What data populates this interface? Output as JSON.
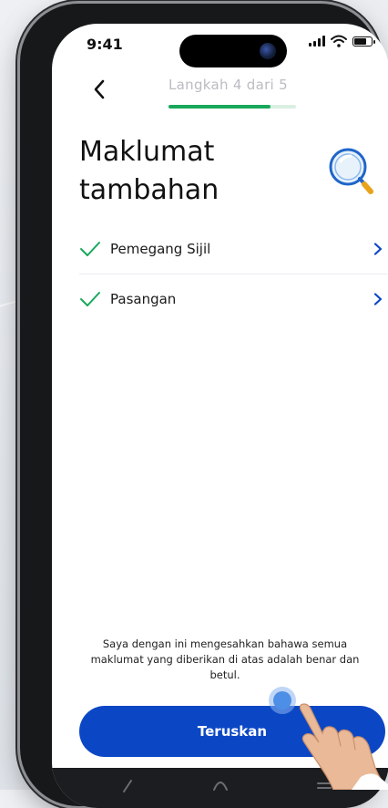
{
  "status_bar": {
    "time": "9:41",
    "signal_icon": "cellular-signal-icon",
    "wifi_icon": "wifi-icon",
    "battery_icon": "battery-icon"
  },
  "header": {
    "back_icon": "chevron-left-icon",
    "step_text": "Langkah 4 dari 5",
    "progress": 0.8
  },
  "page": {
    "title": "Maklumat tambahan",
    "illustration_icon": "magnifier-icon"
  },
  "items": [
    {
      "label": "Pemegang Sijil",
      "status_icon": "check-icon",
      "action_icon": "chevron-right-icon"
    },
    {
      "label": "Pasangan",
      "status_icon": "check-icon",
      "action_icon": "chevron-right-icon"
    }
  ],
  "declaration": "Saya dengan ini mengesahkan bahawa semua maklumat yang diberikan di atas adalah benar dan betul.",
  "cta": {
    "label": "Teruskan"
  },
  "colors": {
    "primary": "#0b47c5",
    "success": "#18a85a",
    "text": "#111111",
    "progress_track": "#d9efe2"
  },
  "nav_bar": {
    "icons": [
      "back-gesture-icon",
      "home-gesture-icon",
      "menu-gesture-icon"
    ]
  }
}
